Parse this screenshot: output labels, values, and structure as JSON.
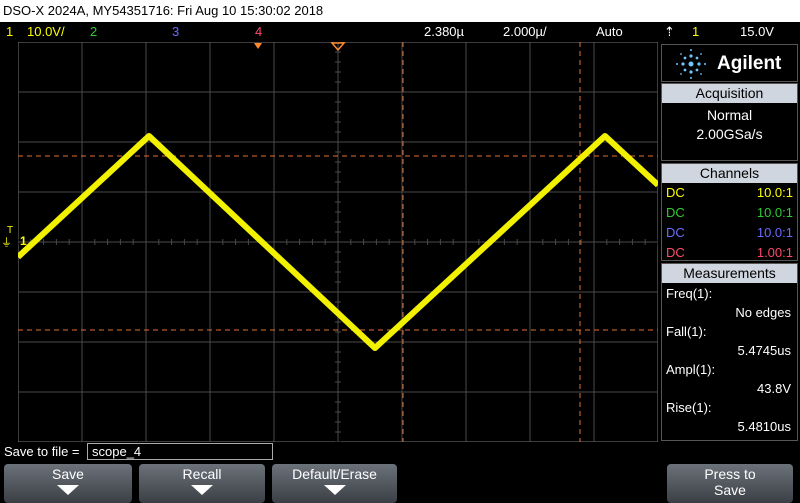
{
  "title_bar": {
    "text": "DSO-X 2024A, MY54351716: Fri Aug 10 15:30:02 2018"
  },
  "status_bar": {
    "channel1": {
      "number": "1",
      "scale": "10.0V/",
      "color": "#ffff00"
    },
    "channel2": {
      "number": "2",
      "color": "#2ecc2e"
    },
    "channel3": {
      "number": "3",
      "color": "#6a6aff"
    },
    "channel4": {
      "number": "4",
      "color": "#ff4a6a"
    },
    "time_offset": "2.380µ",
    "time_scale": "2.000µ/",
    "trigger_mode": "Auto",
    "trigger_source": "1",
    "trigger_level": "15.0V"
  },
  "screen": {
    "ground_marker": "1",
    "trigger_marker": "T"
  },
  "brand": {
    "name": "Agilent"
  },
  "acquisition": {
    "header": "Acquisition",
    "mode": "Normal",
    "rate": "2.00GSa/s"
  },
  "channels": {
    "header": "Channels",
    "rows": [
      {
        "coupling": "DC",
        "probe": "10.0:1",
        "color": "#ffff00"
      },
      {
        "coupling": "DC",
        "probe": "10.0:1",
        "color": "#2ecc2e"
      },
      {
        "coupling": "DC",
        "probe": "10.0:1",
        "color": "#6a6aff"
      },
      {
        "coupling": "DC",
        "probe": "1.00:1",
        "color": "#ff4a6a"
      }
    ]
  },
  "measurements": {
    "header": "Measurements",
    "items": [
      {
        "label": "Freq(1):",
        "value": "No edges"
      },
      {
        "label": "Fall(1):",
        "value": "5.4745us"
      },
      {
        "label": "Ampl(1):",
        "value": "43.8V"
      },
      {
        "label": "Rise(1):",
        "value": "5.4810us"
      }
    ]
  },
  "save_bar": {
    "label": "Save to file =",
    "filename": "scope_4"
  },
  "softkeys": {
    "save": "Save",
    "recall": "Recall",
    "default_erase": "Default/Erase",
    "press_to": "Press to",
    "save2": "Save"
  },
  "colors": {
    "trace": "#f2f200",
    "grid": "#4a4a4a",
    "cursor": "#e07030",
    "panel_header": "#cfd6df"
  }
}
